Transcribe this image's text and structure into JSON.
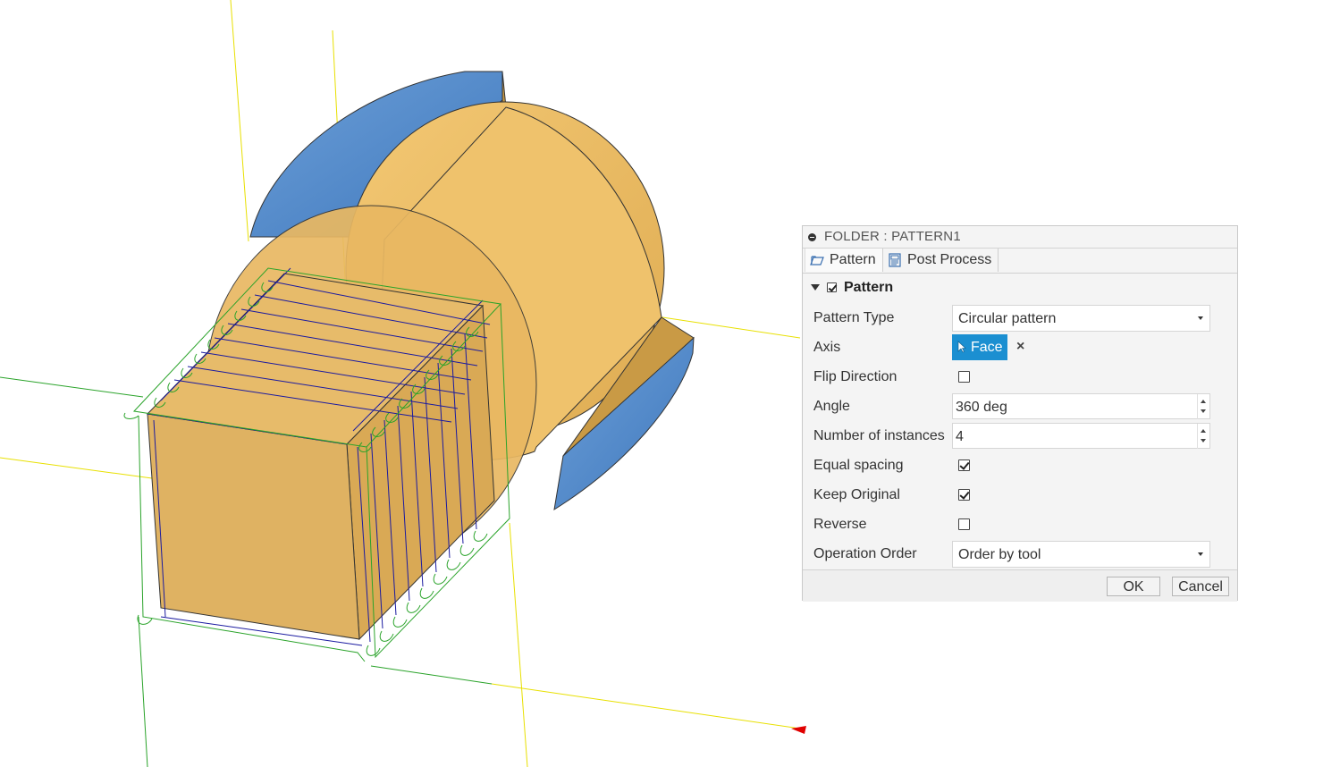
{
  "dialog": {
    "title": "FOLDER : PATTERN1",
    "tabs": [
      {
        "label": "Pattern",
        "icon": "pattern-tab-icon",
        "active": true
      },
      {
        "label": "Post Process",
        "icon": "post-process-icon",
        "active": false
      }
    ],
    "group": {
      "title": "Pattern",
      "checked": true
    },
    "fields": {
      "pattern_type": {
        "label": "Pattern Type",
        "value": "Circular pattern"
      },
      "axis": {
        "label": "Axis",
        "selection": "Face",
        "clear_icon": "×"
      },
      "flip_direction": {
        "label": "Flip Direction",
        "checked": false
      },
      "angle": {
        "label": "Angle",
        "value": "360 deg"
      },
      "instances": {
        "label": "Number of instances",
        "value": "4"
      },
      "equal_spacing": {
        "label": "Equal spacing",
        "checked": true
      },
      "keep_original": {
        "label": "Keep Original",
        "checked": true
      },
      "reverse": {
        "label": "Reverse",
        "checked": false
      },
      "operation_order": {
        "label": "Operation Order",
        "value": "Order by tool"
      }
    },
    "buttons": {
      "ok": "OK",
      "cancel": "Cancel"
    }
  },
  "colors": {
    "accent": "#1b8fd1",
    "body_gold": "#e8b65a",
    "body_blue": "#4a86c8",
    "toolpath_green": "#2aa32a",
    "toolpath_blue": "#1a1aa0",
    "axis_yellow": "#e8e000",
    "axis_red": "#e00000"
  }
}
